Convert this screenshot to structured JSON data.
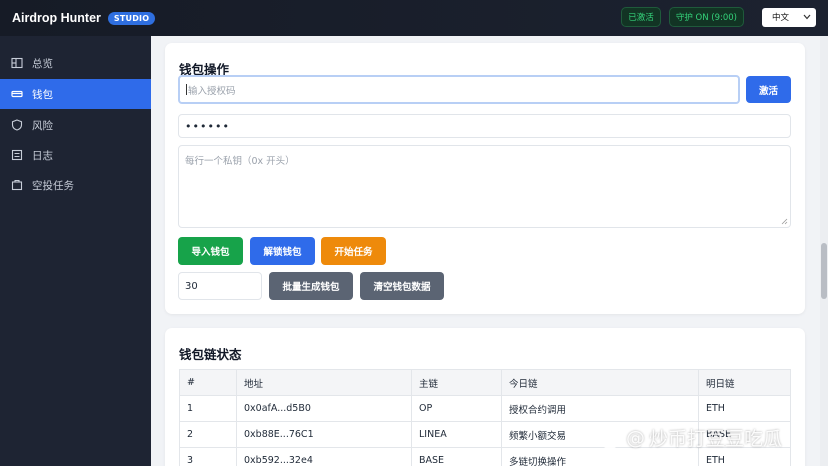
{
  "app": {
    "title": "Airdrop Hunter",
    "badge": "STUDIO"
  },
  "topbar": {
    "status_activated": "已激活",
    "guard_status": "守护 ON (9:00)",
    "language": "中文"
  },
  "sidebar": {
    "items": [
      {
        "label": "总览",
        "icon": "overview-icon"
      },
      {
        "label": "钱包",
        "icon": "wallet-icon",
        "active": true
      },
      {
        "label": "风险",
        "icon": "shield-icon"
      },
      {
        "label": "日志",
        "icon": "log-icon"
      },
      {
        "label": "空投任务",
        "icon": "task-icon"
      }
    ]
  },
  "wallet_ops": {
    "title": "钱包操作",
    "auth_code_placeholder": "输入授权码",
    "activate_label": "激活",
    "password_value": "••••••",
    "private_keys_placeholder": "每行一个私钥（0x 开头）",
    "import_label": "导入钱包",
    "unlock_label": "解锁钱包",
    "start_label": "开始任务",
    "batch_count": "30",
    "batch_generate_label": "批量生成钱包",
    "clear_label": "清空钱包数据"
  },
  "chain_status": {
    "title": "钱包链状态",
    "columns": [
      "#",
      "地址",
      "主链",
      "今日链",
      "明日链"
    ],
    "rows": [
      [
        "1",
        "0x0afA...d5B0",
        "OP",
        "授权合约调用",
        "ETH"
      ],
      [
        "2",
        "0xb88E...76C1",
        "LINEA",
        "频繁小额交易",
        "BASE"
      ],
      [
        "3",
        "0xb592...32e4",
        "BASE",
        "多链切换操作",
        "ETH"
      ]
    ]
  },
  "watermark": {
    "text": "炒币打豆豆吃瓜"
  },
  "colors": {
    "accent": "#2f6bea",
    "sidebar_bg": "#1e2433",
    "topbar_bg": "#161b26",
    "status_green": "#34d27a"
  }
}
